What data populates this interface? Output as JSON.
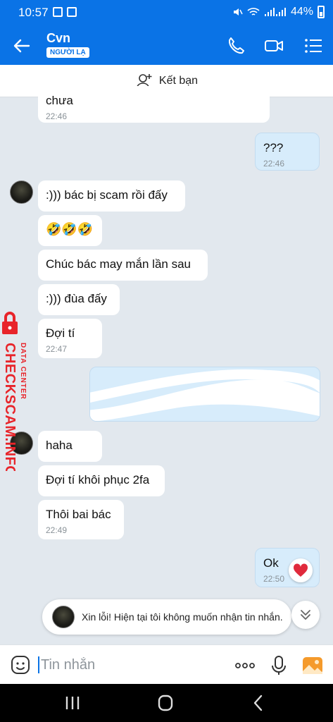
{
  "status_bar": {
    "time": "10:57",
    "battery": "44%"
  },
  "header": {
    "name": "Cvn",
    "badge": "NGƯỜI LẠ"
  },
  "add_friend": {
    "label": "Kết bạn"
  },
  "messages": [
    {
      "dir": "in",
      "text": "chưa",
      "time": "22:46"
    },
    {
      "dir": "out",
      "text": "???",
      "time": "22:46"
    },
    {
      "dir": "in",
      "text": ":))) bác bị scam rồi đấy"
    },
    {
      "dir": "in",
      "text": "🤣🤣🤣"
    },
    {
      "dir": "in",
      "text": "Chúc bác may mắn lần sau"
    },
    {
      "dir": "in",
      "text": ":))) đùa đấy"
    },
    {
      "dir": "in",
      "text": "Đợi tí",
      "time": "22:47"
    },
    {
      "dir": "out",
      "text": "",
      "redacted": true
    },
    {
      "dir": "in",
      "text": "haha"
    },
    {
      "dir": "in",
      "text": "Đợi tí khôi phục 2fa"
    },
    {
      "dir": "in",
      "text": "Thôi bai bác",
      "time": "22:49"
    },
    {
      "dir": "out",
      "text": "Ok",
      "time": "22:50",
      "reaction": "heart-icon"
    }
  ],
  "watermark": {
    "line1": "DATA CENTER",
    "line2": "CHECKSCAM.INFO"
  },
  "notice": {
    "text": "Xin lỗi! Hiện tại tôi không muốn nhận tin nhắn."
  },
  "input": {
    "placeholder": "Tin nhắn"
  },
  "colors": {
    "accent": "#0a73e6",
    "outgoing_bubble": "#d7ecfb",
    "background": "#e2e8ee",
    "watermark": "#e8242a"
  }
}
